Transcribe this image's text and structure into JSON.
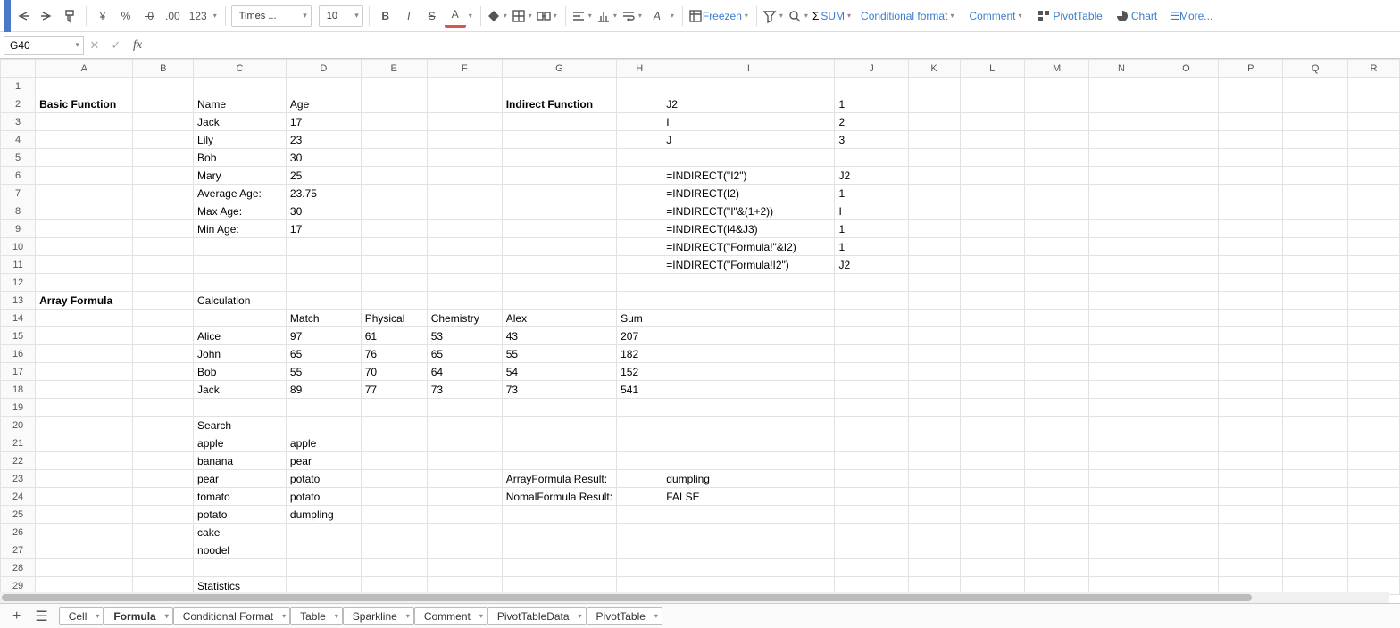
{
  "toolbar": {
    "currency": "¥",
    "percent": "%",
    "dec_dec": ".0",
    "inc_dec": ".00",
    "num_fmt": "123",
    "font": "Times ...",
    "font_size": "10",
    "sum": "SUM",
    "freeze": "Freezen",
    "cond_fmt": "Conditional format",
    "comment": "Comment",
    "pivot": "PivotTable",
    "chart": "Chart",
    "more": "More..."
  },
  "name_box": "G40",
  "columns": [
    "A",
    "B",
    "C",
    "D",
    "E",
    "F",
    "G",
    "H",
    "I",
    "J",
    "K",
    "L",
    "M",
    "N",
    "O",
    "P",
    "Q",
    "R"
  ],
  "cells": {
    "A2": "Basic Function",
    "C2": "Name",
    "D2": "Age",
    "C3": "Jack",
    "D3": "17",
    "C4": "Lily",
    "D4": "23",
    "C5": "Bob",
    "D5": "30",
    "C6": "Mary",
    "D6": "25",
    "C7": "Average Age:",
    "D7": "23.75",
    "C8": "Max Age:",
    "D8": "30",
    "C9": "Min Age:",
    "D9": "17",
    "G2": "Indirect Function",
    "I2": "J2",
    "J2": "1",
    "I3": "I",
    "J3": "2",
    "I4": "J",
    "J4": "3",
    "I6": "=INDIRECT(\"I2\")",
    "J6": "J2",
    "I7": "=INDIRECT(I2)",
    "J7": "1",
    "I8": "=INDIRECT(\"I\"&(1+2))",
    "J8": "I",
    "I9": "=INDIRECT(I4&J3)",
    "J9": "1",
    "I10": "=INDIRECT(\"Formula!\"&I2)",
    "J10": "1",
    "I11": "=INDIRECT(\"Formula!I2\")",
    "J11": "J2",
    "A13": "Array Formula",
    "C13": "Calculation",
    "D14": "Match",
    "E14": "Physical",
    "F14": "Chemistry",
    "G14": "Alex",
    "H14": "Sum",
    "C15": "Alice",
    "D15": "97",
    "E15": "61",
    "F15": "53",
    "G15": "43",
    "H15": "207",
    "C16": "John",
    "D16": "65",
    "E16": "76",
    "F16": "65",
    "G16": "55",
    "H16": "182",
    "C17": "Bob",
    "D17": "55",
    "E17": "70",
    "F17": "64",
    "G17": "54",
    "H17": "152",
    "C18": "Jack",
    "D18": "89",
    "E18": "77",
    "F18": "73",
    "G18": "73",
    "H18": "541",
    "C20": "Search",
    "C21": "apple",
    "D21": "apple",
    "C22": "banana",
    "D22": "pear",
    "C23": "pear",
    "D23": "potato",
    "G23": "ArrayFormula Result:",
    "I23": "dumpling",
    "C24": "tomato",
    "D24": "potato",
    "G24": "NomalFormula Result:",
    "I24": "FALSE",
    "C25": "potato",
    "D25": "dumpling",
    "C26": "cake",
    "C27": "noodel",
    "C29": "Statistics"
  },
  "sheets": [
    "Cell",
    "Formula",
    "Conditional Format",
    "Table",
    "Sparkline",
    "Comment",
    "PivotTableData",
    "PivotTable"
  ],
  "active_sheet": "Formula"
}
